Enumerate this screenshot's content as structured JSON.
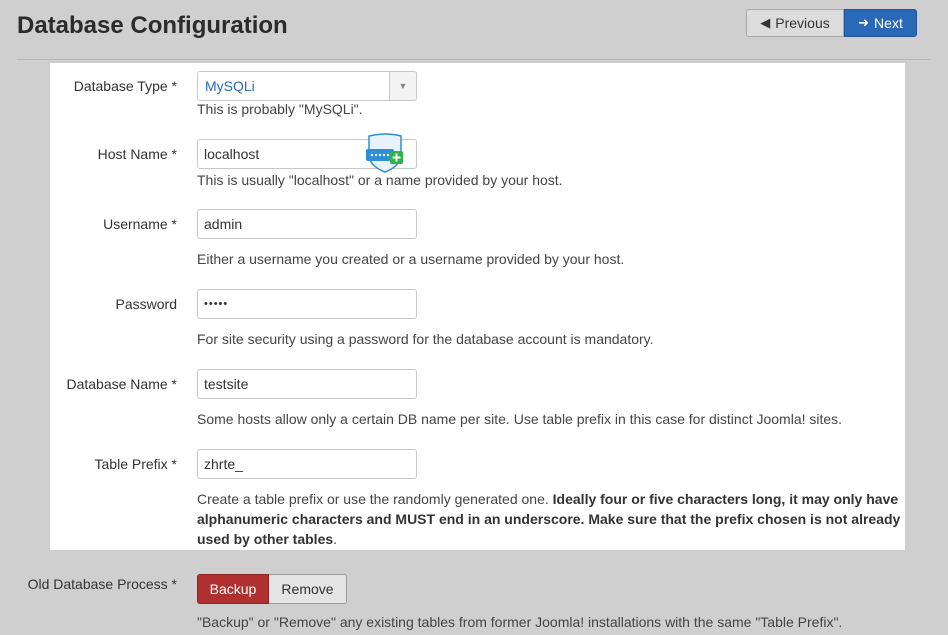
{
  "page": {
    "title": "Database Configuration",
    "previous_label": "Previous",
    "next_label": "Next"
  },
  "fields": {
    "db_type": {
      "label": "Database Type *",
      "value": "MySQLi",
      "help": "This is probably \"MySQLi\"."
    },
    "host": {
      "label": "Host Name *",
      "value": "localhost",
      "help": "This is usually \"localhost\" or a name provided by your host."
    },
    "username": {
      "label": "Username *",
      "value": "admin",
      "help": "Either a username you created or a username provided by your host."
    },
    "password": {
      "label": "Password",
      "value": "•••••",
      "help": "For site security using a password for the database account is mandatory."
    },
    "db_name": {
      "label": "Database Name *",
      "value": "testsite",
      "help": "Some hosts allow only a certain DB name per site. Use table prefix in this case for distinct Joomla! sites."
    },
    "prefix": {
      "label": "Table Prefix *",
      "value": "zhrte_",
      "help_plain": "Create a table prefix or use the randomly generated one. ",
      "help_bold": "Ideally four or five characters long, it may only have alphanumeric characters and MUST end in an underscore. Make sure that the prefix chosen is not already used by other tables",
      "help_end": "."
    },
    "old_db": {
      "label": "Old Database Process *",
      "backup_label": "Backup",
      "remove_label": "Remove",
      "help": "\"Backup\" or \"Remove\" any existing tables from former Joomla! installations with the same \"Table Prefix\"."
    }
  },
  "colors": {
    "accent": "#2a69b8",
    "danger": "#b03030"
  },
  "icons": {
    "prev": "arrow-left-icon",
    "next": "arrow-right-icon",
    "password_manager": "password-manager-icon"
  }
}
